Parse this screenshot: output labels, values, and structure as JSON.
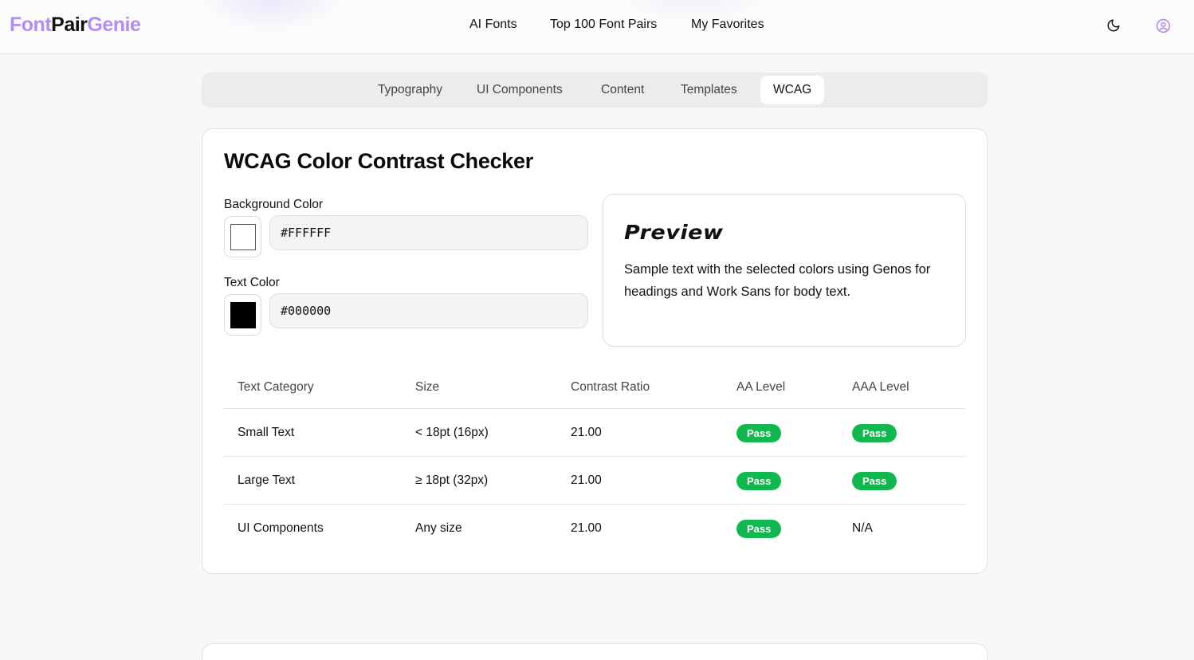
{
  "header": {
    "logo": {
      "part1": "Font",
      "part2": "Pair",
      "part3": "Genie"
    },
    "nav": [
      "AI Fonts",
      "Top 100 Font Pairs",
      "My Favorites"
    ],
    "icons": [
      "moon-icon",
      "user-circle-icon"
    ]
  },
  "tabs": [
    "Typography",
    "UI Components",
    "Content",
    "Templates",
    "WCAG"
  ],
  "active_tab": "WCAG",
  "checker": {
    "title": "WCAG Color Contrast Checker",
    "background_label": "Background Color",
    "background_value": "#FFFFFF",
    "text_label": "Text Color",
    "text_value": "#000000"
  },
  "preview": {
    "title": "Preview",
    "body": "Sample text with the selected colors using Genos for headings and Work Sans for body text."
  },
  "table": {
    "headers": [
      "Text Category",
      "Size",
      "Contrast Ratio",
      "AA Level",
      "AAA Level"
    ],
    "rows": [
      {
        "category": "Small Text",
        "size": "< 18pt (16px)",
        "ratio": "21.00",
        "aa": "Pass",
        "aaa": "Pass"
      },
      {
        "category": "Large Text",
        "size": "≥ 18pt (32px)",
        "ratio": "21.00",
        "aa": "Pass",
        "aaa": "Pass"
      },
      {
        "category": "UI Components",
        "size": "Any size",
        "ratio": "21.00",
        "aa": "Pass",
        "aaa": "N/A"
      }
    ]
  },
  "colors": {
    "accent": "#b58cf0",
    "pass": "#12b84f"
  }
}
